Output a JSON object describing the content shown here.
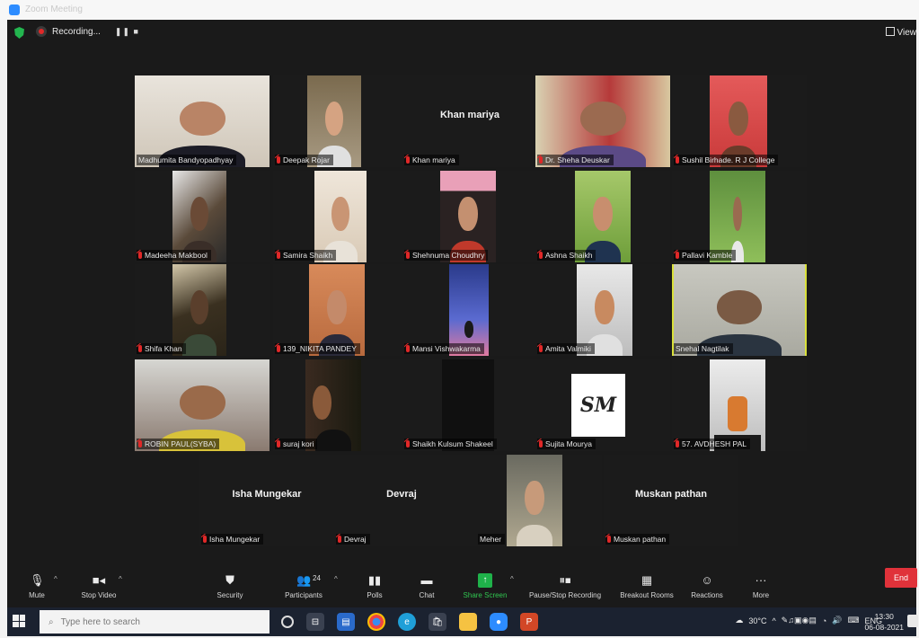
{
  "window": {
    "title": "Zoom Meeting"
  },
  "topbar": {
    "recording_label": "Recording...",
    "recording_controls": "❚❚ ■",
    "view_label": "View"
  },
  "participants": [
    {
      "name": "Madhumita Bandyopadhyay",
      "muted": false
    },
    {
      "name": "Deepak Rojar",
      "muted": true
    },
    {
      "name": "Khan mariya",
      "muted": true,
      "video": false
    },
    {
      "name": "Dr. Sheha Deuskar",
      "muted": true
    },
    {
      "name": "Sushil Birhade. R J College",
      "muted": true
    },
    {
      "name": "Madeeha Makbool",
      "muted": true
    },
    {
      "name": "Samira Shaikh",
      "muted": true
    },
    {
      "name": "Shehnuma Choudhry",
      "muted": true
    },
    {
      "name": "Ashna Shaikh",
      "muted": true
    },
    {
      "name": "Pallavi Kamble",
      "muted": true
    },
    {
      "name": "Shifa Khan",
      "muted": true
    },
    {
      "name": "139_NIKITA PANDEY",
      "muted": true
    },
    {
      "name": "Mansi Vishwakarma",
      "muted": true
    },
    {
      "name": "Amita Valmiki",
      "muted": true
    },
    {
      "name": "Snehal Nagtilak",
      "muted": false,
      "active_speaker": true
    },
    {
      "name": "ROBIN PAUL(SYBA)",
      "muted": true
    },
    {
      "name": "suraj kori",
      "muted": true
    },
    {
      "name": "Shaikh Kulsum Shakeel",
      "muted": true
    },
    {
      "name": "Sujita Mourya",
      "muted": true,
      "avatar_text": "SM"
    },
    {
      "name": "57. AVDHESH PAL",
      "muted": true
    },
    {
      "name": "Isha Mungekar",
      "muted": true,
      "video": false
    },
    {
      "name": "Devraj",
      "muted": true,
      "video": false
    },
    {
      "name": "Meher",
      "muted": false
    },
    {
      "name": "Muskan pathan",
      "muted": true,
      "video": false
    }
  ],
  "toolbar": {
    "mute": "Mute",
    "stop_video": "Stop Video",
    "security": "Security",
    "participants": "Participants",
    "participants_count": "24",
    "polls": "Polls",
    "chat": "Chat",
    "share_screen": "Share Screen",
    "pause_stop_recording": "Pause/Stop Recording",
    "breakout_rooms": "Breakout Rooms",
    "reactions": "Reactions",
    "more": "More",
    "end": "End"
  },
  "taskbar": {
    "search_placeholder": "Type here to search",
    "temperature": "30°C",
    "language": "ENG",
    "time": "13:30",
    "date": "06-08-2021"
  },
  "colors": {
    "meeting_bg": "#1a1a1a",
    "active_speaker_border": "#d9e03a",
    "muted_icon": "#e02828",
    "share_screen": "#1fb24a",
    "end_button": "#e0323a"
  }
}
